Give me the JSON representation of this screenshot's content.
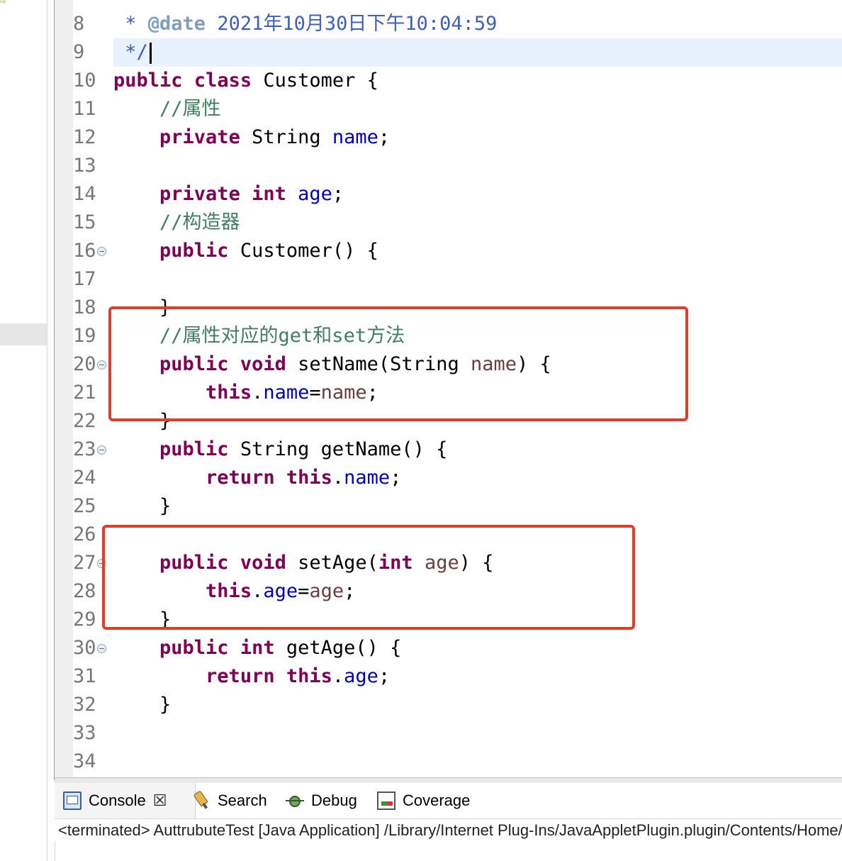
{
  "editor": {
    "lines": [
      {
        "n": "8",
        "fold": false,
        "current": false,
        "tokens": [
          [
            "doc",
            " * "
          ],
          [
            "doctag",
            "@date"
          ],
          [
            "doc",
            " 2021年10月30日下午10:04:59"
          ]
        ]
      },
      {
        "n": "9",
        "fold": false,
        "current": true,
        "tokens": [
          [
            "doc",
            " */"
          ]
        ]
      },
      {
        "n": "10",
        "fold": false,
        "current": false,
        "tokens": [
          [
            "kw",
            "public"
          ],
          [
            "txt",
            " "
          ],
          [
            "kw",
            "class"
          ],
          [
            "txt",
            " Customer {"
          ]
        ]
      },
      {
        "n": "11",
        "fold": false,
        "current": false,
        "tokens": [
          [
            "txt",
            "    "
          ],
          [
            "cmt",
            "//属性"
          ]
        ]
      },
      {
        "n": "12",
        "fold": false,
        "current": false,
        "tokens": [
          [
            "txt",
            "    "
          ],
          [
            "kw",
            "private"
          ],
          [
            "txt",
            " String "
          ],
          [
            "fld",
            "name"
          ],
          [
            "txt",
            ";"
          ]
        ]
      },
      {
        "n": "13",
        "fold": false,
        "current": false,
        "tokens": []
      },
      {
        "n": "14",
        "fold": false,
        "current": false,
        "tokens": [
          [
            "txt",
            "    "
          ],
          [
            "kw",
            "private"
          ],
          [
            "txt",
            " "
          ],
          [
            "kw",
            "int"
          ],
          [
            "txt",
            " "
          ],
          [
            "fld",
            "age"
          ],
          [
            "txt",
            ";"
          ]
        ]
      },
      {
        "n": "15",
        "fold": false,
        "current": false,
        "tokens": [
          [
            "txt",
            "    "
          ],
          [
            "cmt",
            "//构造器"
          ]
        ]
      },
      {
        "n": "16",
        "fold": true,
        "current": false,
        "tokens": [
          [
            "txt",
            "    "
          ],
          [
            "kw",
            "public"
          ],
          [
            "txt",
            " Customer() {"
          ]
        ]
      },
      {
        "n": "17",
        "fold": false,
        "current": false,
        "tokens": []
      },
      {
        "n": "18",
        "fold": false,
        "current": false,
        "tokens": [
          [
            "txt",
            "    }"
          ]
        ]
      },
      {
        "n": "19",
        "fold": false,
        "current": false,
        "tokens": [
          [
            "txt",
            "    "
          ],
          [
            "cmt",
            "//属性对应的get和set方法"
          ]
        ]
      },
      {
        "n": "20",
        "fold": true,
        "current": false,
        "tokens": [
          [
            "txt",
            "    "
          ],
          [
            "kw",
            "public"
          ],
          [
            "txt",
            " "
          ],
          [
            "kw",
            "void"
          ],
          [
            "txt",
            " setName(String "
          ],
          [
            "par",
            "name"
          ],
          [
            "txt",
            ") {"
          ]
        ]
      },
      {
        "n": "21",
        "fold": false,
        "current": false,
        "tokens": [
          [
            "txt",
            "        "
          ],
          [
            "kw",
            "this"
          ],
          [
            "txt",
            "."
          ],
          [
            "fld",
            "name"
          ],
          [
            "txt",
            "="
          ],
          [
            "par",
            "name"
          ],
          [
            "txt",
            ";"
          ]
        ]
      },
      {
        "n": "22",
        "fold": false,
        "current": false,
        "tokens": [
          [
            "txt",
            "    }"
          ]
        ]
      },
      {
        "n": "23",
        "fold": true,
        "current": false,
        "tokens": [
          [
            "txt",
            "    "
          ],
          [
            "kw",
            "public"
          ],
          [
            "txt",
            " String getName() {"
          ]
        ]
      },
      {
        "n": "24",
        "fold": false,
        "current": false,
        "tokens": [
          [
            "txt",
            "        "
          ],
          [
            "kw",
            "return"
          ],
          [
            "txt",
            " "
          ],
          [
            "kw",
            "this"
          ],
          [
            "txt",
            "."
          ],
          [
            "fld",
            "name"
          ],
          [
            "txt",
            ";"
          ]
        ]
      },
      {
        "n": "25",
        "fold": false,
        "current": false,
        "tokens": [
          [
            "txt",
            "    }"
          ]
        ]
      },
      {
        "n": "26",
        "fold": false,
        "current": false,
        "tokens": []
      },
      {
        "n": "27",
        "fold": true,
        "current": false,
        "tokens": [
          [
            "txt",
            "    "
          ],
          [
            "kw",
            "public"
          ],
          [
            "txt",
            " "
          ],
          [
            "kw",
            "void"
          ],
          [
            "txt",
            " setAge("
          ],
          [
            "kw",
            "int"
          ],
          [
            "txt",
            " "
          ],
          [
            "par",
            "age"
          ],
          [
            "txt",
            ") {"
          ]
        ]
      },
      {
        "n": "28",
        "fold": false,
        "current": false,
        "tokens": [
          [
            "txt",
            "        "
          ],
          [
            "kw",
            "this"
          ],
          [
            "txt",
            "."
          ],
          [
            "fld",
            "age"
          ],
          [
            "txt",
            "="
          ],
          [
            "par",
            "age"
          ],
          [
            "txt",
            ";"
          ]
        ]
      },
      {
        "n": "29",
        "fold": false,
        "current": false,
        "tokens": [
          [
            "txt",
            "    }"
          ]
        ]
      },
      {
        "n": "30",
        "fold": true,
        "current": false,
        "tokens": [
          [
            "txt",
            "    "
          ],
          [
            "kw",
            "public"
          ],
          [
            "txt",
            " "
          ],
          [
            "kw",
            "int"
          ],
          [
            "txt",
            " getAge() {"
          ]
        ]
      },
      {
        "n": "31",
        "fold": false,
        "current": false,
        "tokens": [
          [
            "txt",
            "        "
          ],
          [
            "kw",
            "return"
          ],
          [
            "txt",
            " "
          ],
          [
            "kw",
            "this"
          ],
          [
            "txt",
            "."
          ],
          [
            "fld",
            "age"
          ],
          [
            "txt",
            ";"
          ]
        ]
      },
      {
        "n": "32",
        "fold": false,
        "current": false,
        "tokens": [
          [
            "txt",
            "    }"
          ]
        ]
      },
      {
        "n": "33",
        "fold": false,
        "current": false,
        "tokens": []
      },
      {
        "n": "34",
        "fold": false,
        "current": false,
        "tokens": []
      }
    ]
  },
  "console": {
    "tabs": [
      {
        "label": "Console",
        "icon": "console-icon",
        "active": true
      },
      {
        "label": "Search",
        "icon": "search-icon",
        "active": false
      },
      {
        "label": "Debug",
        "icon": "debug-icon",
        "active": false
      },
      {
        "label": "Coverage",
        "icon": "coverage-icon",
        "active": false
      }
    ],
    "close_glyph": "☒",
    "status": "<terminated> AuttrubuteTest [Java Application] /Library/Internet Plug-Ins/JavaAppletPlugin.plugin/Contents/Home/bin/java"
  },
  "colors": {
    "keyword": "#7f0055",
    "field": "#0000c0",
    "parameter": "#6a3e3e",
    "comment": "#3f7f5f",
    "javadoc": "#3f5fbf",
    "highlight_box": "#e03e2d"
  }
}
